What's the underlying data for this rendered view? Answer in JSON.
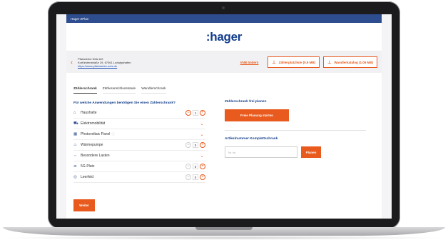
{
  "topbar": {
    "title": "Hager ZPlan"
  },
  "brand": {
    "logo": ":hager",
    "accent": "#e85a1d",
    "primary": "#143e8c"
  },
  "company": {
    "name": "Pfalzwerke Netz AG",
    "street": "Kurfürstenstraße 29, 67061 Ludwigshafen",
    "url": "https://www.pfalzwerke-netz.de"
  },
  "header_actions": {
    "vnb_link": "VNB ändern",
    "datasheet_label": "Zählerplatzliste (0.9 MB)",
    "catalog_label": "Wandlerkatalog (1.05 MB)",
    "download_icon": "download-icon"
  },
  "tabs": [
    {
      "label": "Zählerschrank",
      "active": true
    },
    {
      "label": "Zähleranschlusssäule",
      "active": false
    },
    {
      "label": "Wandlerschrank",
      "active": false
    }
  ],
  "question": "Für welche Anwendungen benötigen Sie einen Zählerschrank?",
  "applications": [
    {
      "label": "Haushalte",
      "icon": "house-icon",
      "control": "stepper",
      "value": "1"
    },
    {
      "label": "Elektromobilität",
      "icon": "car-icon",
      "control": "expand"
    },
    {
      "label": "Photovoltaic Panel",
      "icon": "solar-panel-icon",
      "control": "expand",
      "info": "ⓘ"
    },
    {
      "label": "Wärmepumpe",
      "icon": "heat-pump-icon",
      "control": "stepper",
      "value": "0"
    },
    {
      "label": "Besondere Lasten",
      "icon": "load-icon",
      "control": "expand"
    },
    {
      "label": "5G-Platz",
      "icon": "antenna-icon",
      "control": "stepper",
      "value": "0"
    },
    {
      "label": "Leerfeld",
      "icon": "empty-field-icon",
      "control": "stepper",
      "value": "0"
    }
  ],
  "weiter_label": "Weiter",
  "free_plan": {
    "title": "Zählerschrank frei planen",
    "button": "Freie Planung starten"
  },
  "article": {
    "title": "Artikelnummer Komplettschrank",
    "placeholder": "Nr. ist",
    "button": "Planen"
  }
}
